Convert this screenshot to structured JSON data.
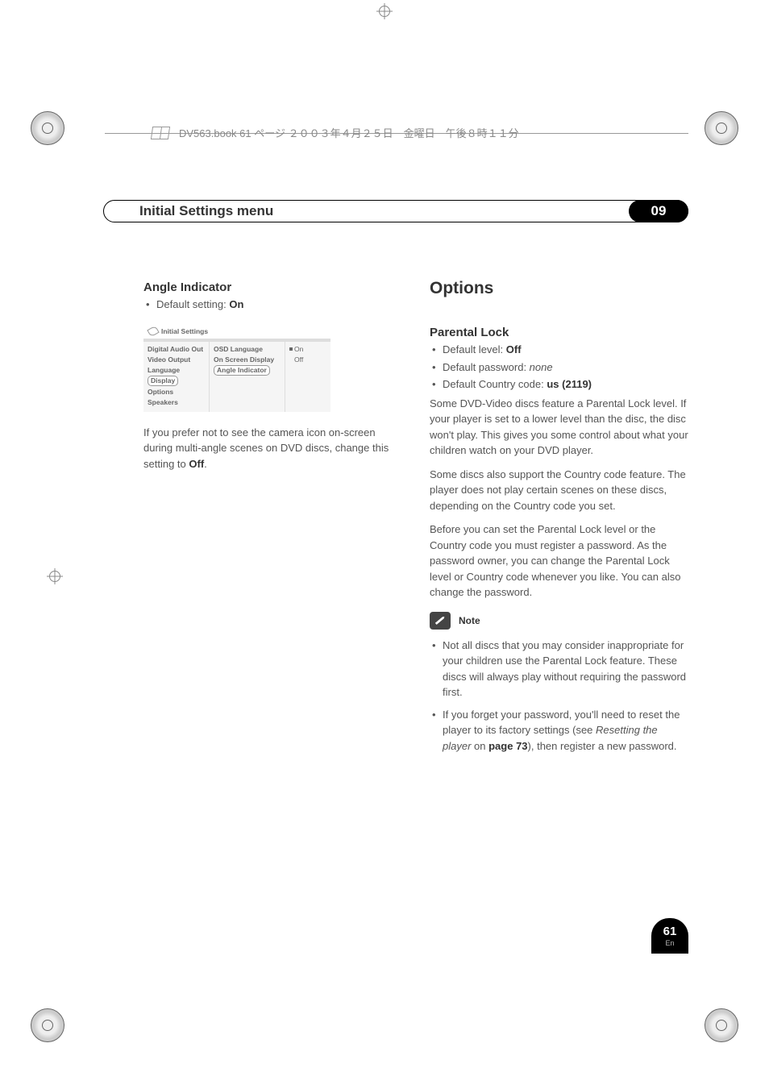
{
  "header": {
    "filename": "DV563.book  61 ページ  ２００３年４月２５日　金曜日　午後８時１１分"
  },
  "section": {
    "title": "Initial Settings menu",
    "number": "09"
  },
  "left_col": {
    "heading": "Angle Indicator",
    "default_label": "Default setting: ",
    "default_value": "On",
    "menu": {
      "title": "Initial Settings",
      "col1": [
        "Digital Audio Out",
        "Video Output",
        "Language",
        "Display",
        "Options",
        "Speakers"
      ],
      "col2": [
        "OSD Language",
        "On Screen Display",
        "Angle Indicator"
      ],
      "col3": [
        "On",
        "Off"
      ],
      "highlight_col1": "Display",
      "highlight_col2": "Angle Indicator"
    },
    "body_prefix": "If you prefer not to see the camera icon on-screen during multi-angle scenes on DVD discs, change this setting to ",
    "body_bold": "Off",
    "body_suffix": "."
  },
  "right_col": {
    "heading": "Options",
    "sub_heading": "Parental Lock",
    "default_level_label": "Default level: ",
    "default_level_value": "Off",
    "default_pw_label": "Default password: ",
    "default_pw_value": "none",
    "default_cc_label": "Default Country code: ",
    "default_cc_value": "us (2119)",
    "para1": "Some DVD-Video discs feature a Parental Lock level. If your player is set to a lower level than the disc, the disc won't play. This gives you some control about what your children watch on your DVD player.",
    "para2": "Some discs also support the Country code feature. The player does not play certain scenes on these discs, depending on the Country code you set.",
    "para3": "Before you can set the Parental Lock level or the Country code you must register a password. As the password owner, you can change the Parental Lock level or Country code whenever you like. You can also change the password.",
    "note_label": "Note",
    "note1": "Not all discs that you may consider inappropriate for your children use the Parental Lock feature. These discs will always play without requiring the password first.",
    "note2_prefix": "If you forget your password, you'll need to reset the player to its factory settings (see ",
    "note2_ital": "Resetting the player",
    "note2_mid": " on ",
    "note2_bold": "page 73",
    "note2_suffix": "), then register a new password."
  },
  "footer": {
    "page": "61",
    "lang": "En"
  }
}
